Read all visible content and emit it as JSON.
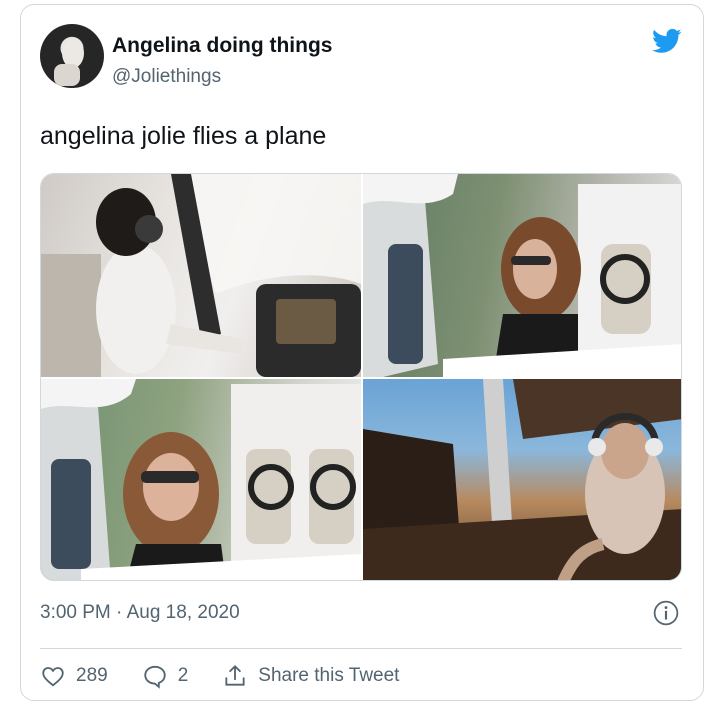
{
  "account": {
    "display_name": "Angelina doing things",
    "handle": "@Joliethings"
  },
  "tweet": {
    "text": "angelina jolie flies a plane",
    "timestamp": "3:00 PM · Aug 18, 2020"
  },
  "media": {
    "photo_count": 4
  },
  "actions": {
    "like_count": "289",
    "reply_count": "2",
    "share_label": "Share this Tweet"
  },
  "icons": [
    "twitter-bird-icon",
    "info-icon",
    "heart-icon",
    "reply-icon",
    "share-icon"
  ],
  "colors": {
    "brand": "#1d9bf0",
    "secondary_text": "#536471",
    "border": "#cfd9de"
  }
}
